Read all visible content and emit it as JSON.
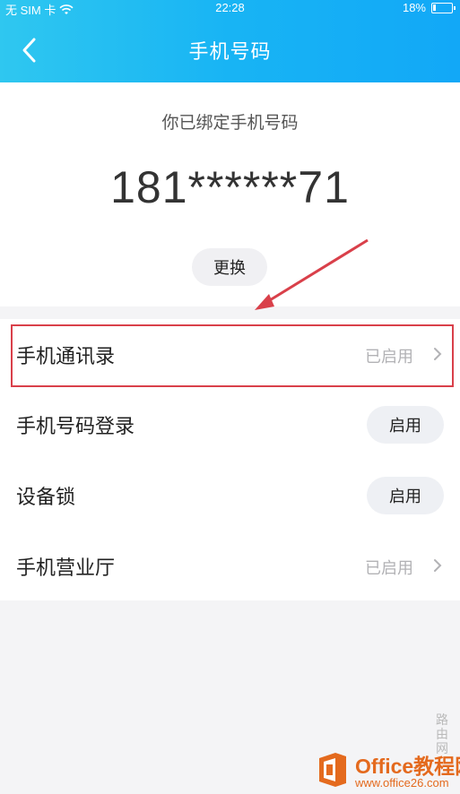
{
  "status_bar": {
    "carrier": "无 SIM 卡",
    "time": "22:28",
    "battery_percent_text": "18%",
    "battery_level": 0.18
  },
  "header": {
    "title": "手机号码"
  },
  "info": {
    "bound_label": "你已绑定手机号码",
    "phone_number": "181******71",
    "change_label": "更换"
  },
  "list": [
    {
      "label": "手机通讯录",
      "status": "已启用",
      "control": "chevron"
    },
    {
      "label": "手机号码登录",
      "button": "启用",
      "control": "button"
    },
    {
      "label": "设备锁",
      "button": "启用",
      "control": "button"
    },
    {
      "label": "手机营业厅",
      "status": "已启用",
      "control": "chevron"
    }
  ],
  "watermark": {
    "brand": "Office教程网",
    "url": "www.office26.com",
    "side_text": "路由网"
  },
  "colors": {
    "header_start": "#2fc7f0",
    "header_end": "#12a8f7",
    "highlight": "#d9404a",
    "watermark": "#e46a1e"
  }
}
